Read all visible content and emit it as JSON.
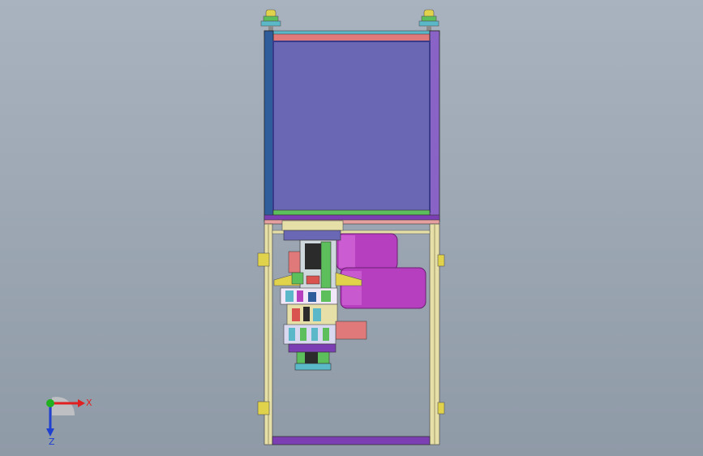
{
  "viewport": {
    "background_top": "#a9b3bf",
    "background_bottom": "#8f9aa7"
  },
  "colors": {
    "frame_left": "#2f5d9c",
    "frame_right": "#8a63c7",
    "panel": "#6a67b5",
    "panel_border": "#3a3a8a",
    "top_bar": "#e07a7a",
    "bottom_bar": "#7b3fb3",
    "leg": "#e6e0a8",
    "motor": "#b63fbf",
    "motor_light": "#d46ad8",
    "yellow_part": "#e0d24a",
    "green_part": "#5cbf5c",
    "cyan_part": "#5ab8c9",
    "red_part": "#d9534f",
    "axis_x": "#e02020",
    "axis_y": "#20b020",
    "axis_z": "#2040d0"
  },
  "triad": {
    "x_label": "X",
    "z_label": "Z",
    "x_icon": "x-axis-arrow-icon",
    "y_icon": "y-axis-origin-icon",
    "z_icon": "z-axis-arrow-icon"
  }
}
